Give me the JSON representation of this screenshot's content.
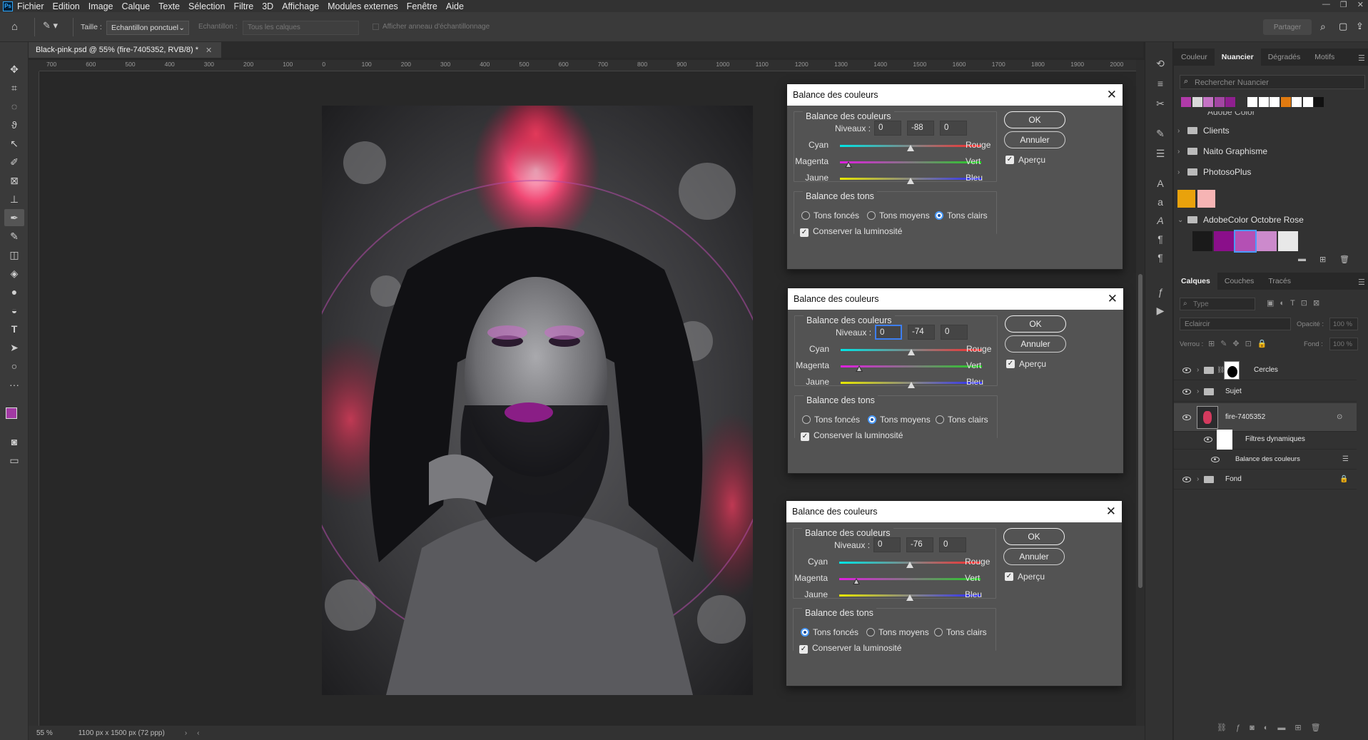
{
  "menu": {
    "items": [
      "Fichier",
      "Edition",
      "Image",
      "Calque",
      "Texte",
      "Sélection",
      "Filtre",
      "3D",
      "Affichage",
      "Modules externes",
      "Fenêtre",
      "Aide"
    ]
  },
  "options": {
    "size_label": "Taille :",
    "size_value": "Echantillon ponctuel",
    "sample_label": "Echantillon :",
    "sample_value": "Tous les calques",
    "ring_label": "Afficher anneau d'échantillonnage",
    "share_label": "Partager"
  },
  "document": {
    "tab_title": "Black-pink.psd @ 55% (fire-7405352, RVB/8) *",
    "zoom": "55 %",
    "doc_info": "1100 px x 1500 px (72 ppp)"
  },
  "ruler": {
    "h_ticks": [
      "700",
      "600",
      "500",
      "400",
      "300",
      "200",
      "100",
      "0",
      "100",
      "200",
      "300",
      "400",
      "500",
      "600",
      "700",
      "800",
      "900",
      "1000",
      "1100",
      "1200",
      "1300",
      "1400",
      "1500",
      "1600",
      "1700",
      "1800",
      "1900",
      "2000"
    ]
  },
  "dialogs": [
    {
      "title": "Balance des couleurs",
      "section_balance": "Balance des couleurs",
      "levels_label": "Niveaux :",
      "levels": [
        "0",
        "-88",
        "0"
      ],
      "rows": [
        {
          "left": "Cyan",
          "right": "Rouge",
          "knob": 0.5
        },
        {
          "left": "Magenta",
          "right": "Vert",
          "knob": 0.06
        },
        {
          "left": "Jaune",
          "right": "Bleu",
          "knob": 0.5
        }
      ],
      "section_tones": "Balance des tons",
      "tones": [
        "Tons foncés",
        "Tons moyens",
        "Tons clairs"
      ],
      "selected_tone": 2,
      "preserve": "Conserver la luminosité",
      "ok": "OK",
      "cancel": "Annuler",
      "preview": "Aperçu"
    },
    {
      "title": "Balance des couleurs",
      "section_balance": "Balance des couleurs",
      "levels_label": "Niveaux :",
      "levels": [
        "0",
        "-74",
        "0"
      ],
      "rows": [
        {
          "left": "Cyan",
          "right": "Rouge",
          "knob": 0.5
        },
        {
          "left": "Magenta",
          "right": "Vert",
          "knob": 0.13
        },
        {
          "left": "Jaune",
          "right": "Bleu",
          "knob": 0.5
        }
      ],
      "section_tones": "Balance des tons",
      "tones": [
        "Tons foncés",
        "Tons moyens",
        "Tons clairs"
      ],
      "selected_tone": 1,
      "preserve": "Conserver la luminosité",
      "ok": "OK",
      "cancel": "Annuler",
      "preview": "Aperçu"
    },
    {
      "title": "Balance des couleurs",
      "section_balance": "Balance des couleurs",
      "levels_label": "Niveaux :",
      "levels": [
        "0",
        "-76",
        "0"
      ],
      "rows": [
        {
          "left": "Cyan",
          "right": "Rouge",
          "knob": 0.5
        },
        {
          "left": "Magenta",
          "right": "Vert",
          "knob": 0.12
        },
        {
          "left": "Jaune",
          "right": "Bleu",
          "knob": 0.5
        }
      ],
      "section_tones": "Balance des tons",
      "tones": [
        "Tons foncés",
        "Tons moyens",
        "Tons clairs"
      ],
      "selected_tone": 0,
      "preserve": "Conserver la luminosité",
      "ok": "OK",
      "cancel": "Annuler",
      "preview": "Aperçu"
    }
  ],
  "swatches_panel": {
    "tabs": [
      "Couleur",
      "Nuancier",
      "Dégradés",
      "Motifs"
    ],
    "active_tab": 1,
    "search_placeholder": "Rechercher Nuancier",
    "top_swatches": [
      "#b03aa8",
      "#d9d9d9",
      "#c473c4",
      "#a346a3",
      "#8f1f8f",
      "#333333",
      "#ffffff",
      "#ffffff",
      "#ffffff",
      "#e07a10",
      "#ffffff",
      "#ffffff",
      "#111111"
    ],
    "partial_group": "Adobe Color",
    "groups": [
      "Clients",
      "Naito Graphisme",
      "PhotosoPlus"
    ],
    "loose_swatches": [
      "#e9a20c",
      "#f6b4b4"
    ],
    "open_group": "AdobeColor Octobre Rose",
    "open_group_swatches": [
      "#1a1a1a",
      "#8a0f8a",
      "#b450b4",
      "#cc8acc",
      "#e8e8e8"
    ]
  },
  "layers_panel": {
    "tabs": [
      "Calques",
      "Couches",
      "Tracés"
    ],
    "filter_placeholder": "Type",
    "blend_mode": "Eclaircir",
    "opacity_label": "Opacité :",
    "opacity_value": "100 %",
    "lock_label": "Verrou :",
    "fill_label": "Fond :",
    "fill_value": "100 %",
    "layers": [
      {
        "name": "Cercles",
        "kind": "group"
      },
      {
        "name": "Sujet",
        "kind": "group"
      },
      {
        "name": "fire-7405352",
        "kind": "smart"
      },
      {
        "name": "Filtres dynamiques",
        "kind": "filters"
      },
      {
        "name": "Balance des couleurs",
        "kind": "filter"
      },
      {
        "name": "Fond",
        "kind": "group"
      }
    ]
  }
}
